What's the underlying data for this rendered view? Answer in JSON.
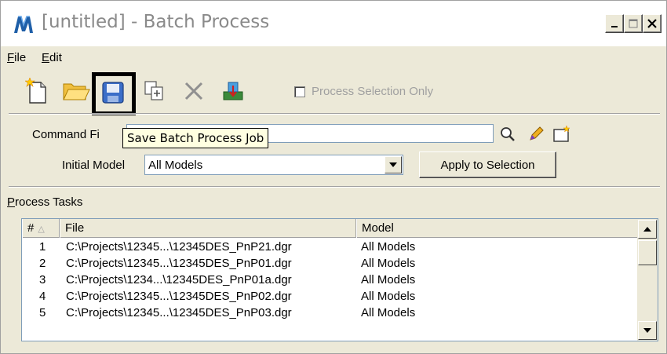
{
  "window": {
    "title": "[untitled] - Batch Process",
    "icon": "batch-process-app-icon",
    "controls": [
      "minimize",
      "maximize",
      "close"
    ]
  },
  "menu": {
    "file": "File",
    "edit": "Edit"
  },
  "toolbar": {
    "buttons": [
      "new-file",
      "open-folder",
      "save",
      "copy-add",
      "delete",
      "run-batch"
    ],
    "highlighted": "save",
    "process_selection_label": "Process Selection Only",
    "process_selection_checked": false
  },
  "tooltip": {
    "text": "Save Batch Process Job"
  },
  "command_file": {
    "label": "Command Fi",
    "value": ""
  },
  "initial_model": {
    "label": "Initial Model",
    "selected": "All Models"
  },
  "apply_button": "Apply to Selection",
  "process_tasks": {
    "label": "Process Tasks",
    "columns": [
      "#",
      "File",
      "Model"
    ],
    "rows": [
      {
        "num": "1",
        "file": "C:\\Projects\\12345...\\12345DES_PnP21.dgr",
        "model": "All Models"
      },
      {
        "num": "2",
        "file": "C:\\Projects\\12345...\\12345DES_PnP01.dgr",
        "model": "All Models"
      },
      {
        "num": "3",
        "file": "C:\\Projects\\1234...\\12345DES_PnP01a.dgr",
        "model": "All Models"
      },
      {
        "num": "4",
        "file": "C:\\Projects\\12345...\\12345DES_PnP02.dgr",
        "model": "All Models"
      },
      {
        "num": "5",
        "file": "C:\\Projects\\12345...\\12345DES_PnP03.dgr",
        "model": "All Models"
      }
    ]
  },
  "colors": {
    "window_bg": "#ece9d8",
    "title_text": "#8a8a8a",
    "tooltip_bg": "#ffffe1",
    "highlight_border": "#000000"
  }
}
